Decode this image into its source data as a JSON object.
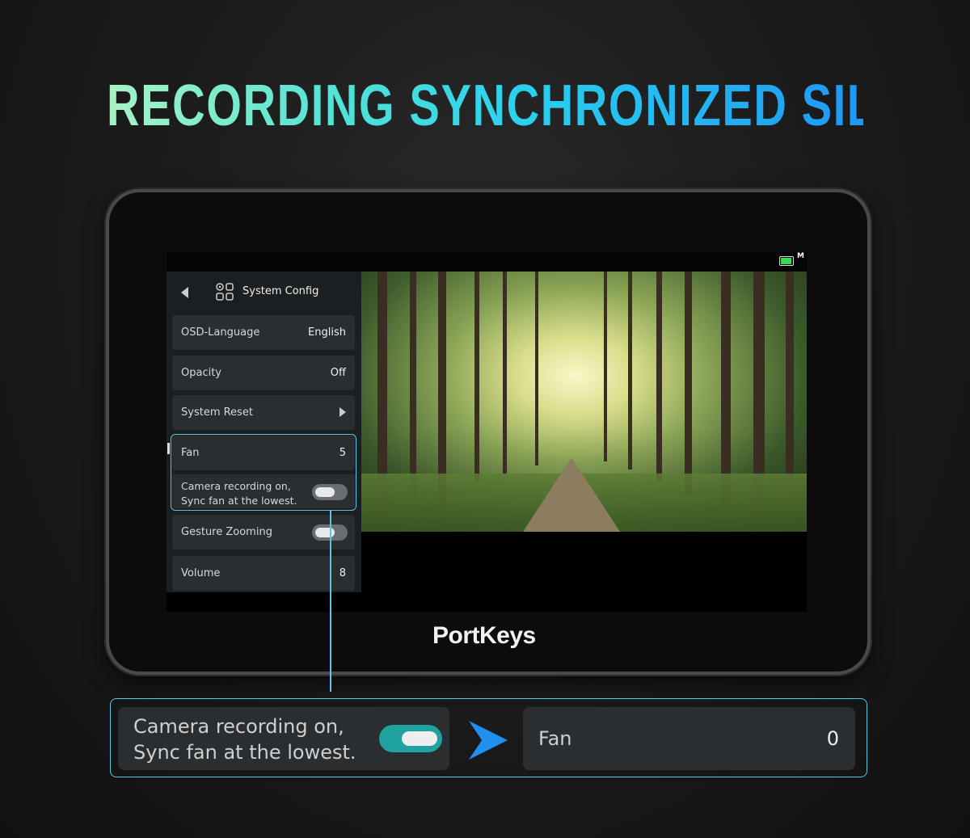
{
  "headline": {
    "part1": "RECORDING ",
    "part2": "SYNCHRONIZED SILENT FAN"
  },
  "device": {
    "brand": "PortKeys",
    "battery_mode": "M"
  },
  "menu": {
    "title": "System Config",
    "items": [
      {
        "label": "OSD-Language",
        "value": "English"
      },
      {
        "label": "Opacity",
        "value": "Off"
      },
      {
        "label": "System Reset",
        "value": ""
      },
      {
        "label": "Fan",
        "value": "5"
      },
      {
        "label": "Gesture Zooming",
        "value": ""
      },
      {
        "label": "Volume",
        "value": "8"
      }
    ],
    "sync_option": {
      "line1": "Camera recording on,",
      "line2": "Sync fan at the lowest.",
      "enabled": false
    },
    "gesture_zooming_enabled": false
  },
  "callout": {
    "sync_line1": "Camera recording on,",
    "sync_line2": "Sync fan at the lowest.",
    "sync_enabled": true,
    "fan_label": "Fan",
    "fan_value": "0"
  },
  "colors": {
    "accent": "#5ac7e8",
    "toggle_on": "#1fa3a0",
    "toggle_off": "#6a6e72",
    "battery": "#33d94e",
    "arrow": "#1e90f0"
  },
  "icons": {
    "back": "back-arrow-icon",
    "config": "settings-grid-icon",
    "battery": "battery-icon",
    "display": "display-frame-icon",
    "next": "chevron-right-icon"
  }
}
